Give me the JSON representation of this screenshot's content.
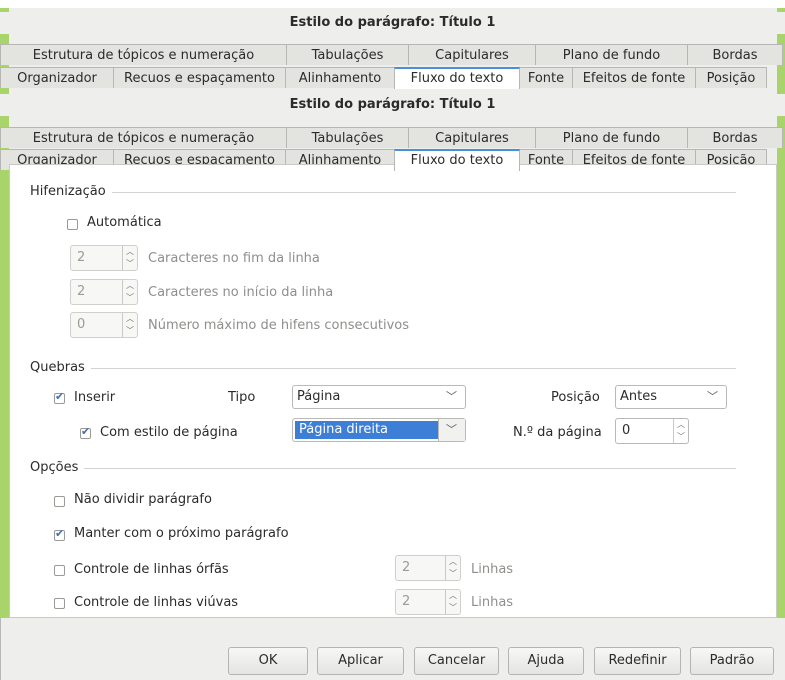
{
  "window": {
    "title": "Estilo do parágrafo: Título 1"
  },
  "tabs_row1": [
    "Estrutura de tópicos e numeração",
    "Tabulações",
    "Capitulares",
    "Plano de fundo",
    "Bordas"
  ],
  "tabs_row2": [
    "Organizador",
    "Recuos e espaçamento",
    "Alinhamento",
    "Fluxo do texto",
    "Fonte",
    "Efeitos de fonte",
    "Posição"
  ],
  "hyphenation": {
    "title": "Hifenização",
    "automatic": {
      "label": "Automática",
      "checked": false
    },
    "chars_end": {
      "value": "2",
      "label": "Caracteres no fim da linha"
    },
    "chars_start": {
      "value": "2",
      "label": "Caracteres no início da linha"
    },
    "max_hyphens": {
      "value": "0",
      "label": "Número máximo de hifens consecutivos"
    }
  },
  "breaks": {
    "title": "Quebras",
    "insert": {
      "label": "Inserir",
      "checked": true
    },
    "type_label": "Tipo",
    "type_value": "Página",
    "position_label": "Posição",
    "position_value": "Antes",
    "with_page_style": {
      "label": "Com estilo de página",
      "checked": true
    },
    "page_style_value": "Página direita",
    "page_number_label": "N.º da página",
    "page_number_value": "0"
  },
  "options": {
    "title": "Opções",
    "dont_split": {
      "label": "Não dividir parágrafo",
      "checked": false
    },
    "keep_with_next": {
      "label": "Manter com o próximo parágrafo",
      "checked": true
    },
    "orphan": {
      "label": "Controle de linhas órfãs",
      "checked": false,
      "value": "2",
      "unit": "Linhas"
    },
    "widow": {
      "label": "Controle de linhas viúvas",
      "checked": false,
      "value": "2",
      "unit": "Linhas"
    }
  },
  "buttons": {
    "ok": "OK",
    "apply": "Aplicar",
    "cancel": "Cancelar",
    "help": "Ajuda",
    "reset": "Redefinir",
    "standard": "Padrão"
  },
  "colors": {
    "accent": "#4a90d9",
    "selection": "#3d7fd6",
    "background_green": "#a9d46b"
  }
}
